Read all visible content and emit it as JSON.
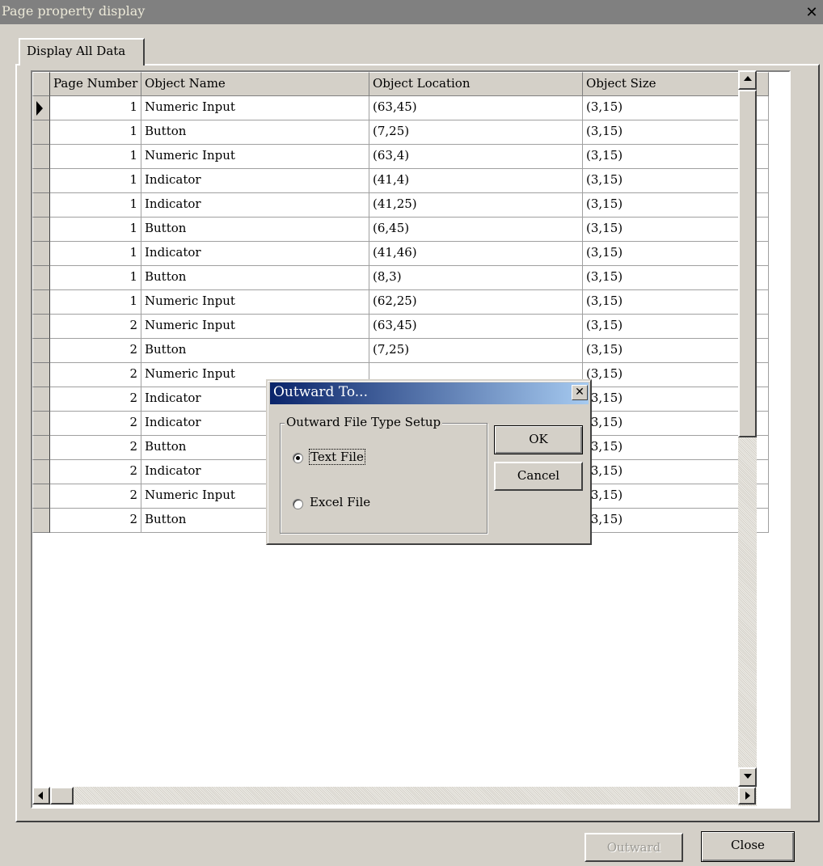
{
  "window": {
    "title": "Page property display",
    "close_symbol": "✕"
  },
  "tabs": [
    {
      "label": "Display All Data"
    }
  ],
  "grid": {
    "columns": [
      "Page Number",
      "Object Name",
      "Object Location",
      "Object Size"
    ],
    "rows": [
      {
        "page": "1",
        "name": "Numeric Input",
        "location": "(63,45)",
        "size": "(3,15)"
      },
      {
        "page": "1",
        "name": "Button",
        "location": "(7,25)",
        "size": "(3,15)"
      },
      {
        "page": "1",
        "name": "Numeric Input",
        "location": "(63,4)",
        "size": "(3,15)"
      },
      {
        "page": "1",
        "name": "Indicator",
        "location": "(41,4)",
        "size": "(3,15)"
      },
      {
        "page": "1",
        "name": "Indicator",
        "location": "(41,25)",
        "size": "(3,15)"
      },
      {
        "page": "1",
        "name": "Button",
        "location": "(6,45)",
        "size": "(3,15)"
      },
      {
        "page": "1",
        "name": "Indicator",
        "location": "(41,46)",
        "size": "(3,15)"
      },
      {
        "page": "1",
        "name": "Button",
        "location": "(8,3)",
        "size": "(3,15)"
      },
      {
        "page": "1",
        "name": "Numeric Input",
        "location": "(62,25)",
        "size": "(3,15)"
      },
      {
        "page": "2",
        "name": "Numeric Input",
        "location": "(63,45)",
        "size": "(3,15)"
      },
      {
        "page": "2",
        "name": "Button",
        "location": "(7,25)",
        "size": "(3,15)"
      },
      {
        "page": "2",
        "name": "Numeric Input",
        "location": "",
        "size": "(3,15)"
      },
      {
        "page": "2",
        "name": "Indicator",
        "location": "",
        "size": "(3,15)"
      },
      {
        "page": "2",
        "name": "Indicator",
        "location": "",
        "size": "(3,15)"
      },
      {
        "page": "2",
        "name": "Button",
        "location": "",
        "size": "(3,15)"
      },
      {
        "page": "2",
        "name": "Indicator",
        "location": "",
        "size": "(3,15)"
      },
      {
        "page": "2",
        "name": "Numeric Input",
        "location": "",
        "size": "(3,15)"
      },
      {
        "page": "2",
        "name": "Button",
        "location": "",
        "size": "(3,15)"
      }
    ]
  },
  "footer": {
    "outward_label": "Outward",
    "close_label": "Close"
  },
  "dialog": {
    "title": "Outward To...",
    "close_symbol": "✕",
    "group_label": "Outward File Type Setup",
    "options": [
      {
        "label": "Text File",
        "selected": true
      },
      {
        "label": "Excel File",
        "selected": false
      }
    ],
    "ok_label": "OK",
    "cancel_label": "Cancel"
  },
  "colors": {
    "face": "#d4d0c8",
    "dialog_title_start": "#0a246a",
    "dialog_title_end": "#a6caf0",
    "disabled_text": "#9c9a94"
  }
}
